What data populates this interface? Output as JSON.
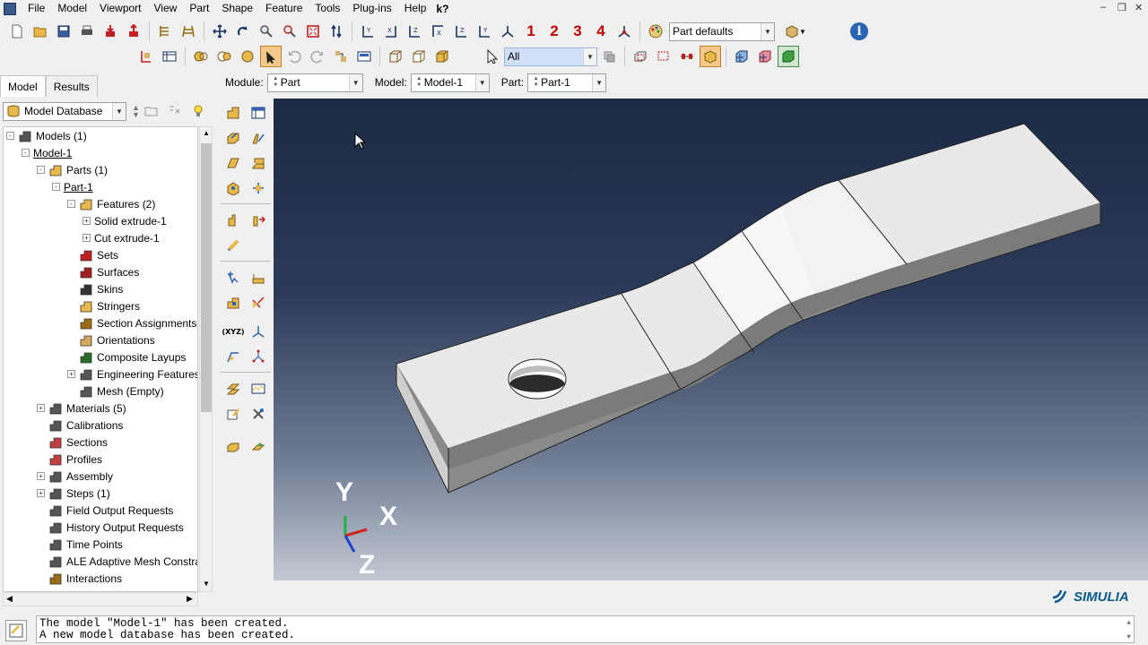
{
  "menubar": {
    "items": [
      "File",
      "Model",
      "Viewport",
      "View",
      "Part",
      "Shape",
      "Feature",
      "Tools",
      "Plug-ins",
      "Help"
    ],
    "help_query": "k?"
  },
  "toolbar1": {
    "view_numbers": [
      "1",
      "2",
      "3",
      "4"
    ],
    "display_group": "Part defaults",
    "info_icon": "i"
  },
  "toolbar2": {
    "selection_filter": "All"
  },
  "context": {
    "module_label": "Module:",
    "module_value": "Part",
    "model_label": "Model:",
    "model_value": "Model-1",
    "part_label": "Part:",
    "part_value": "Part-1"
  },
  "left_panel": {
    "tabs": [
      "Model",
      "Results"
    ],
    "database": "Model Database"
  },
  "tree": [
    {
      "label": "Models (1)",
      "level": 0,
      "exp": "-",
      "icon": "models-icon"
    },
    {
      "label": "Model-1",
      "level": 1,
      "exp": "-",
      "icon": "",
      "underline": true
    },
    {
      "label": "Parts (1)",
      "level": 2,
      "exp": "-",
      "icon": "parts-icon"
    },
    {
      "label": "Part-1",
      "level": 3,
      "exp": "-",
      "icon": "",
      "underline": true
    },
    {
      "label": "Features (2)",
      "level": 4,
      "exp": "-",
      "icon": "features-icon"
    },
    {
      "label": "Solid extrude-1",
      "level": 5,
      "exp": "+",
      "icon": ""
    },
    {
      "label": "Cut extrude-1",
      "level": 5,
      "exp": "+",
      "icon": ""
    },
    {
      "label": "Sets",
      "level": 4,
      "exp": "",
      "icon": "sets-icon"
    },
    {
      "label": "Surfaces",
      "level": 4,
      "exp": "",
      "icon": "surfaces-icon"
    },
    {
      "label": "Skins",
      "level": 4,
      "exp": "",
      "icon": "skins-icon"
    },
    {
      "label": "Stringers",
      "level": 4,
      "exp": "",
      "icon": "stringers-icon"
    },
    {
      "label": "Section Assignments",
      "level": 4,
      "exp": "",
      "icon": "section-assign-icon"
    },
    {
      "label": "Orientations",
      "level": 4,
      "exp": "",
      "icon": "orientations-icon"
    },
    {
      "label": "Composite Layups",
      "level": 4,
      "exp": "",
      "icon": "layups-icon"
    },
    {
      "label": "Engineering Features",
      "level": 4,
      "exp": "+",
      "icon": "eng-features-icon"
    },
    {
      "label": "Mesh (Empty)",
      "level": 4,
      "exp": "",
      "icon": "mesh-icon"
    },
    {
      "label": "Materials (5)",
      "level": 2,
      "exp": "+",
      "icon": "materials-icon"
    },
    {
      "label": "Calibrations",
      "level": 2,
      "exp": "",
      "icon": "calibrations-icon"
    },
    {
      "label": "Sections",
      "level": 2,
      "exp": "",
      "icon": "sections-icon"
    },
    {
      "label": "Profiles",
      "level": 2,
      "exp": "",
      "icon": "profiles-icon"
    },
    {
      "label": "Assembly",
      "level": 2,
      "exp": "+",
      "icon": "assembly-icon"
    },
    {
      "label": "Steps (1)",
      "level": 2,
      "exp": "+",
      "icon": "steps-icon"
    },
    {
      "label": "Field Output Requests",
      "level": 2,
      "exp": "",
      "icon": "field-output-icon"
    },
    {
      "label": "History Output Requests",
      "level": 2,
      "exp": "",
      "icon": "history-output-icon"
    },
    {
      "label": "Time Points",
      "level": 2,
      "exp": "",
      "icon": "time-points-icon"
    },
    {
      "label": "ALE Adaptive Mesh Constra",
      "level": 2,
      "exp": "",
      "icon": "ale-icon"
    },
    {
      "label": "Interactions",
      "level": 2,
      "exp": "",
      "icon": "interactions-icon"
    }
  ],
  "triad": {
    "x": "X",
    "y": "Y",
    "z": "Z"
  },
  "brand": "SIMULIA",
  "messages": [
    "The model \"Model-1\" has been created.",
    "A new model database has been created."
  ]
}
